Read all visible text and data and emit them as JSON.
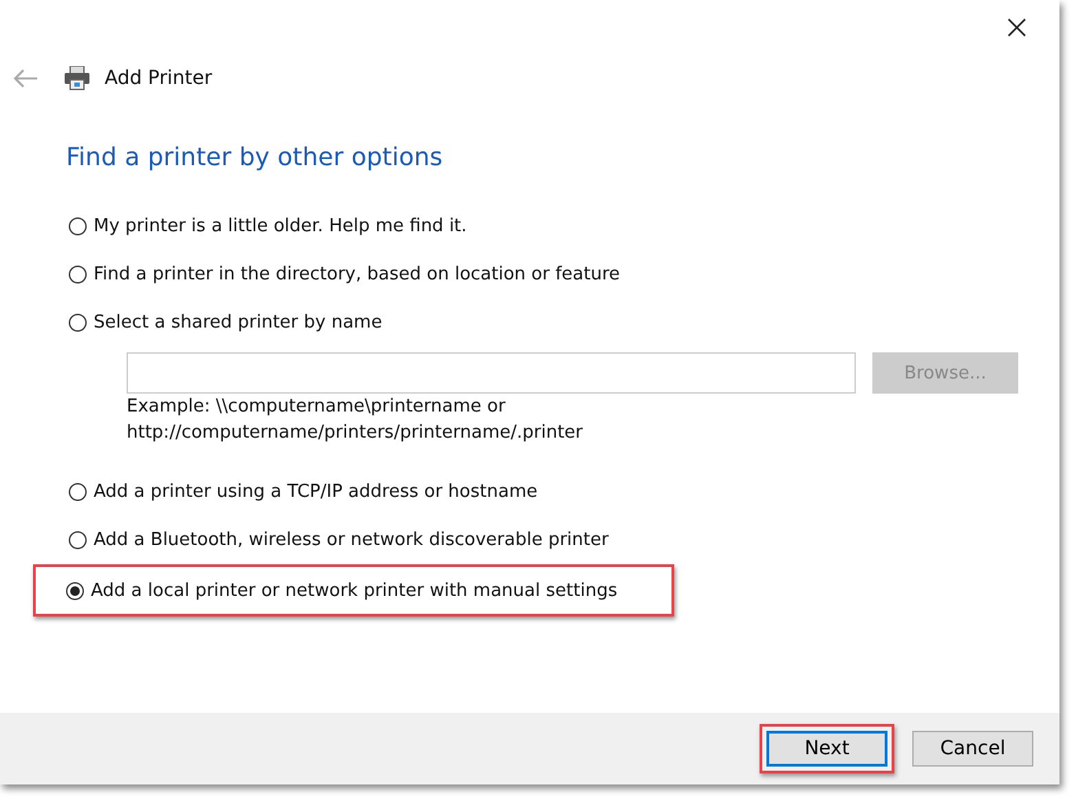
{
  "window": {
    "title": "Add Printer",
    "back_disabled": true
  },
  "heading": "Find a printer by other options",
  "options": [
    {
      "label": "My printer is a little older. Help me find it.",
      "selected": false,
      "highlighted": false
    },
    {
      "label": "Find a printer in the directory, based on location or feature",
      "selected": false,
      "highlighted": false
    },
    {
      "label": "Select a shared printer by name",
      "selected": false,
      "highlighted": false,
      "field": {
        "browse": "Browse...",
        "browse_disabled": true,
        "example": [
          "Example: \\\\computername\\printername or",
          "http://computername/printers/printername/.printer"
        ]
      }
    },
    {
      "label": "Add a printer using a TCP/IP address or hostname",
      "selected": false,
      "highlighted": false
    },
    {
      "label": "Add a Bluetooth, wireless or network discoverable printer",
      "selected": false,
      "highlighted": false
    },
    {
      "label": "Add a local printer or network printer with manual settings",
      "selected": true,
      "highlighted": true
    }
  ],
  "buttons": [
    {
      "label": "Next",
      "default": true,
      "highlighted": true
    },
    {
      "label": "Cancel",
      "default": false,
      "highlighted": false
    }
  ]
}
